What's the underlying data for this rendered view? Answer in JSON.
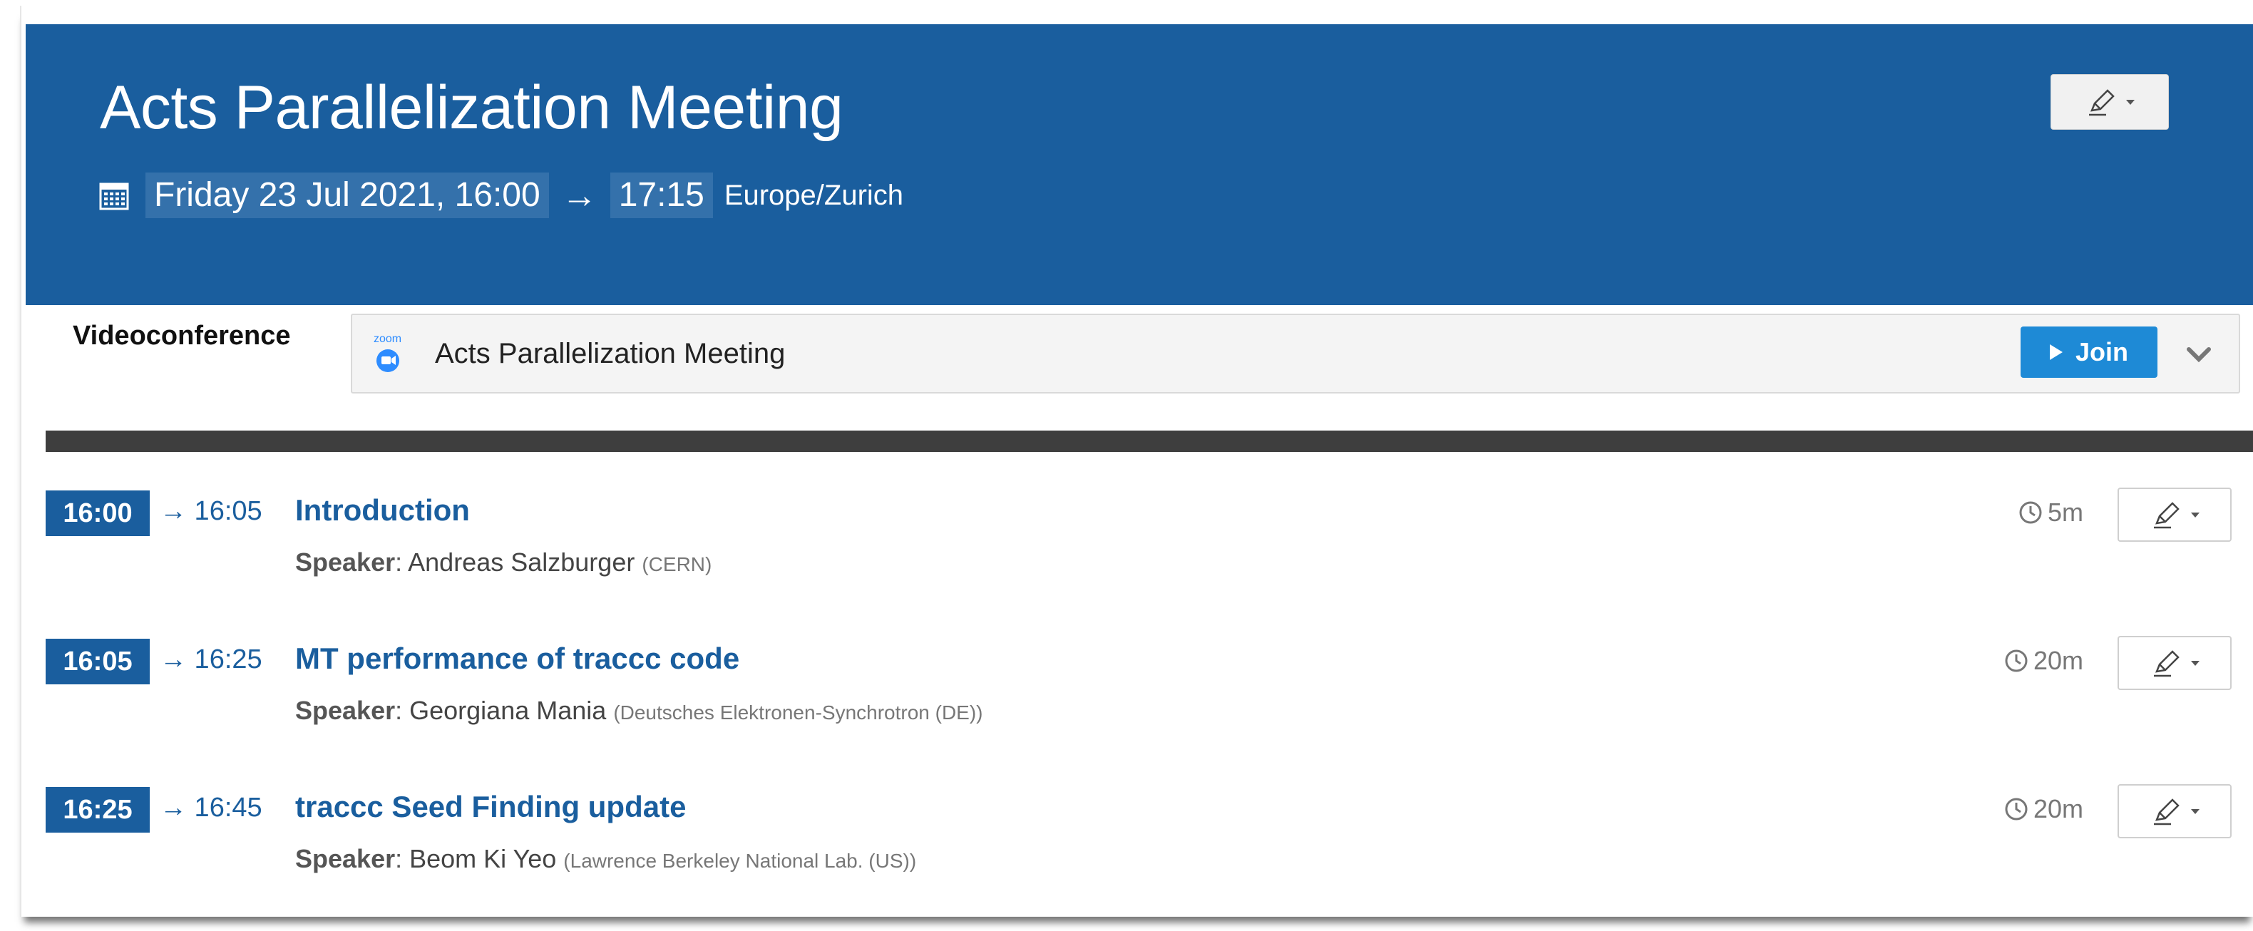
{
  "event": {
    "title": "Acts Parallelization Meeting",
    "date_start": "Friday 23 Jul 2021, 16:00",
    "arrow": "→",
    "time_end": "17:15",
    "timezone": "Europe/Zurich"
  },
  "videoconference": {
    "label": "Videoconference",
    "provider_icon": "zoom-logo",
    "room_name": "Acts Parallelization Meeting",
    "join_label": "Join"
  },
  "contributions": [
    {
      "start": "16:00",
      "end": "→ 16:05",
      "title": "Introduction",
      "speaker_label": "Speaker",
      "speaker": "Andreas Salzburger",
      "affiliation": "(CERN)",
      "duration": "5m"
    },
    {
      "start": "16:05",
      "end": "→ 16:25",
      "title": "MT performance of traccc code",
      "speaker_label": "Speaker",
      "speaker": "Georgiana Mania",
      "affiliation": "(Deutsches Elektronen-Synchrotron (DE))",
      "duration": "20m"
    },
    {
      "start": "16:25",
      "end": "→ 16:45",
      "title": "traccc Seed Finding update",
      "speaker_label": "Speaker",
      "speaker": "Beom Ki Yeo",
      "affiliation": "(Lawrence Berkeley National Lab. (US))",
      "duration": "20m"
    }
  ],
  "colors": {
    "header_bg": "#1a5e9e",
    "link": "#1a5e9e",
    "join_button": "#1e8ad6",
    "divider": "#3e3e3e"
  },
  "icons": [
    "calendar-icon",
    "edit-pencil-icon",
    "zoom-logo",
    "play-icon",
    "chevron-down-icon",
    "clock-icon"
  ]
}
